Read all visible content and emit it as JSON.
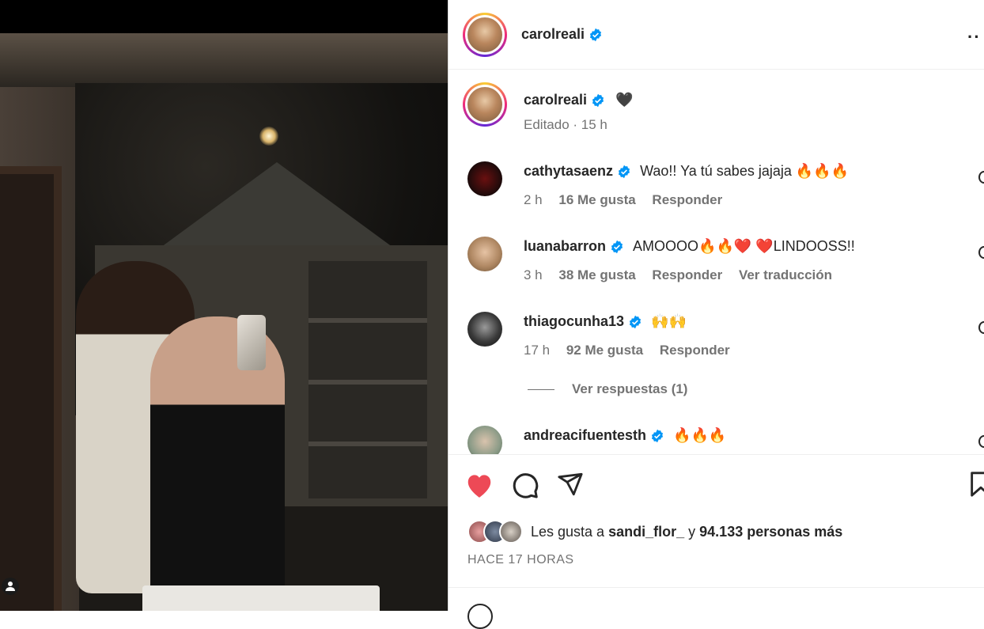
{
  "post": {
    "author": "carolreali",
    "verified": true,
    "caption_emoji": "🖤",
    "caption_meta": "Editado · 15 h"
  },
  "comments": [
    {
      "user": "cathytasaenz",
      "text": "Wao!! Ya tú sabes jajaja 🔥🔥🔥",
      "time": "2 h",
      "likes": "16 Me gusta",
      "reply": "Responder",
      "translate": ""
    },
    {
      "user": "luanabarron",
      "text": "AMOOOO🔥🔥❤️ ❤️LINDOOSS!!",
      "time": "3 h",
      "likes": "38 Me gusta",
      "reply": "Responder",
      "translate": "Ver traducción"
    },
    {
      "user": "thiagocunha13",
      "text": "🙌🙌",
      "time": "17 h",
      "likes": "92 Me gusta",
      "reply": "Responder",
      "translate": ""
    },
    {
      "user": "andreacifuentesth",
      "text": "🔥🔥🔥",
      "time": "",
      "likes": "",
      "reply": "",
      "translate": ""
    }
  ],
  "view_replies": "Ver respuestas (1)",
  "likes": {
    "prefix": "Les gusta a",
    "user": "sandi_flor_",
    "middle": "y",
    "count": "94.133 personas más"
  },
  "timestamp": "HACE 17 HORAS",
  "colors": {
    "like_red": "#ed4956",
    "verified_blue": "#0095f6",
    "muted": "#737373"
  }
}
